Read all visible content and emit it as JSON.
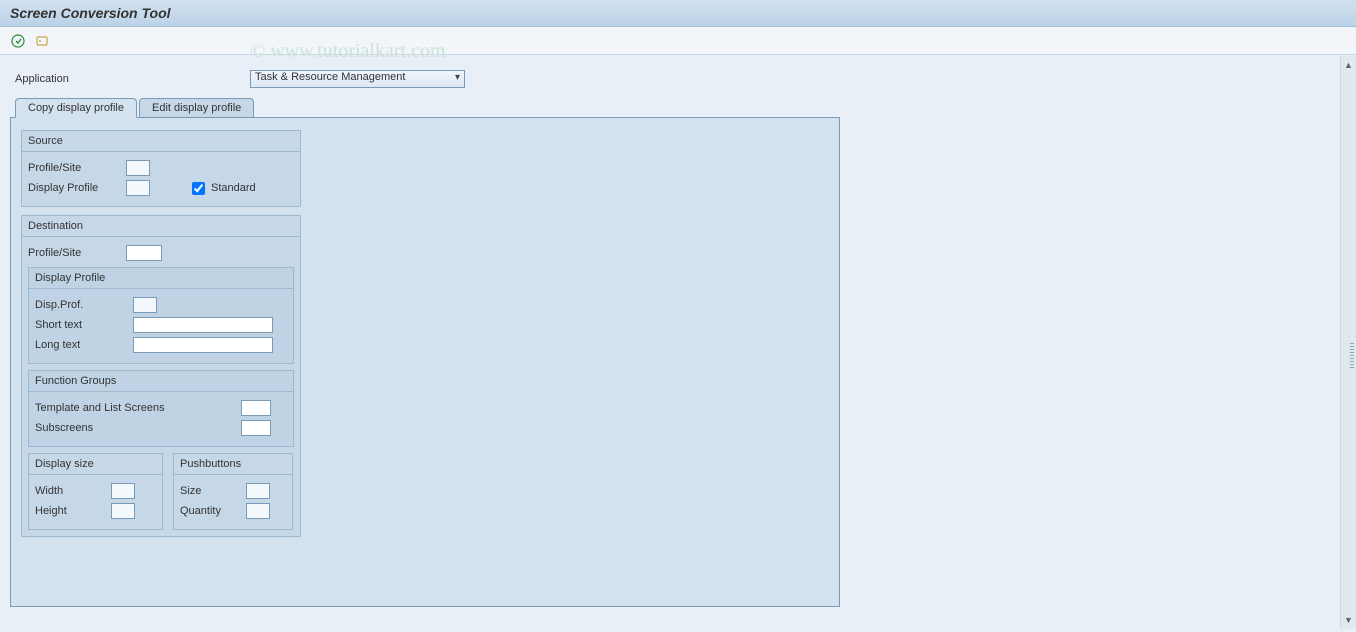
{
  "title": "Screen Conversion Tool",
  "watermark": "© www.tutorialkart.com",
  "app_label": "Application",
  "app_value": "Task & Resource Management",
  "tabs": {
    "copy": "Copy display profile",
    "edit": "Edit display profile"
  },
  "groups": {
    "source": {
      "title": "Source",
      "profile_site": "Profile/Site",
      "display_profile": "Display Profile",
      "standard": "Standard",
      "standard_checked": true
    },
    "destination": {
      "title": "Destination",
      "profile_site": "Profile/Site",
      "display_profile": {
        "title": "Display Profile",
        "disp_prof": "Disp.Prof.",
        "short_text": "Short text",
        "long_text": "Long text"
      },
      "function_groups": {
        "title": "Function Groups",
        "template": "Template and List Screens",
        "subscreens": "Subscreens"
      },
      "display_size": {
        "title": "Display size",
        "width": "Width",
        "height": "Height"
      },
      "pushbuttons": {
        "title": "Pushbuttons",
        "size": "Size",
        "quantity": "Quantity"
      }
    }
  }
}
